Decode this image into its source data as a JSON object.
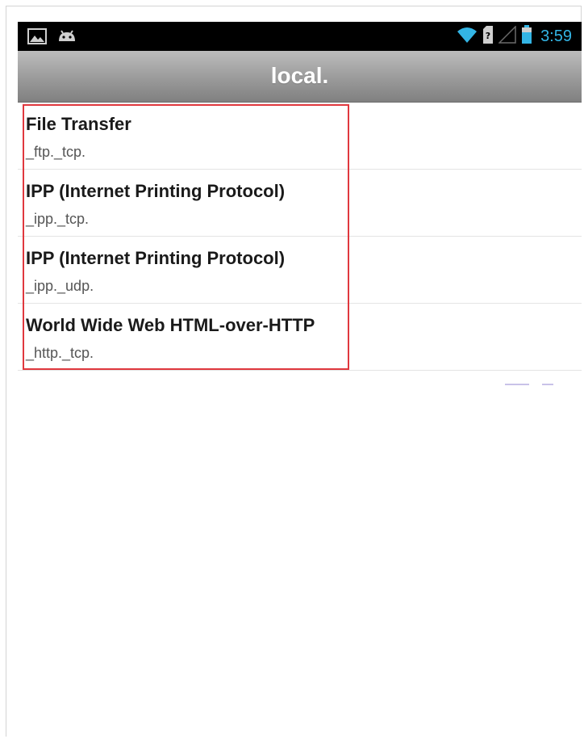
{
  "status_bar": {
    "time": "3:59",
    "left_icons": [
      "image-icon",
      "android-icon"
    ],
    "right_icons": [
      "wifi-icon",
      "sim-icon",
      "signal-icon",
      "battery-icon"
    ],
    "accent_color": "#33b5e5"
  },
  "action_bar": {
    "title": "local."
  },
  "services": [
    {
      "name": "File Transfer",
      "type": "_ftp._tcp."
    },
    {
      "name": "IPP (Internet Printing Protocol)",
      "type": "_ipp._tcp."
    },
    {
      "name": "IPP (Internet Printing Protocol)",
      "type": "_ipp._udp."
    },
    {
      "name": "World Wide Web HTML-over-HTTP",
      "type": "_http._tcp."
    }
  ],
  "highlight_color": "#e0383e"
}
